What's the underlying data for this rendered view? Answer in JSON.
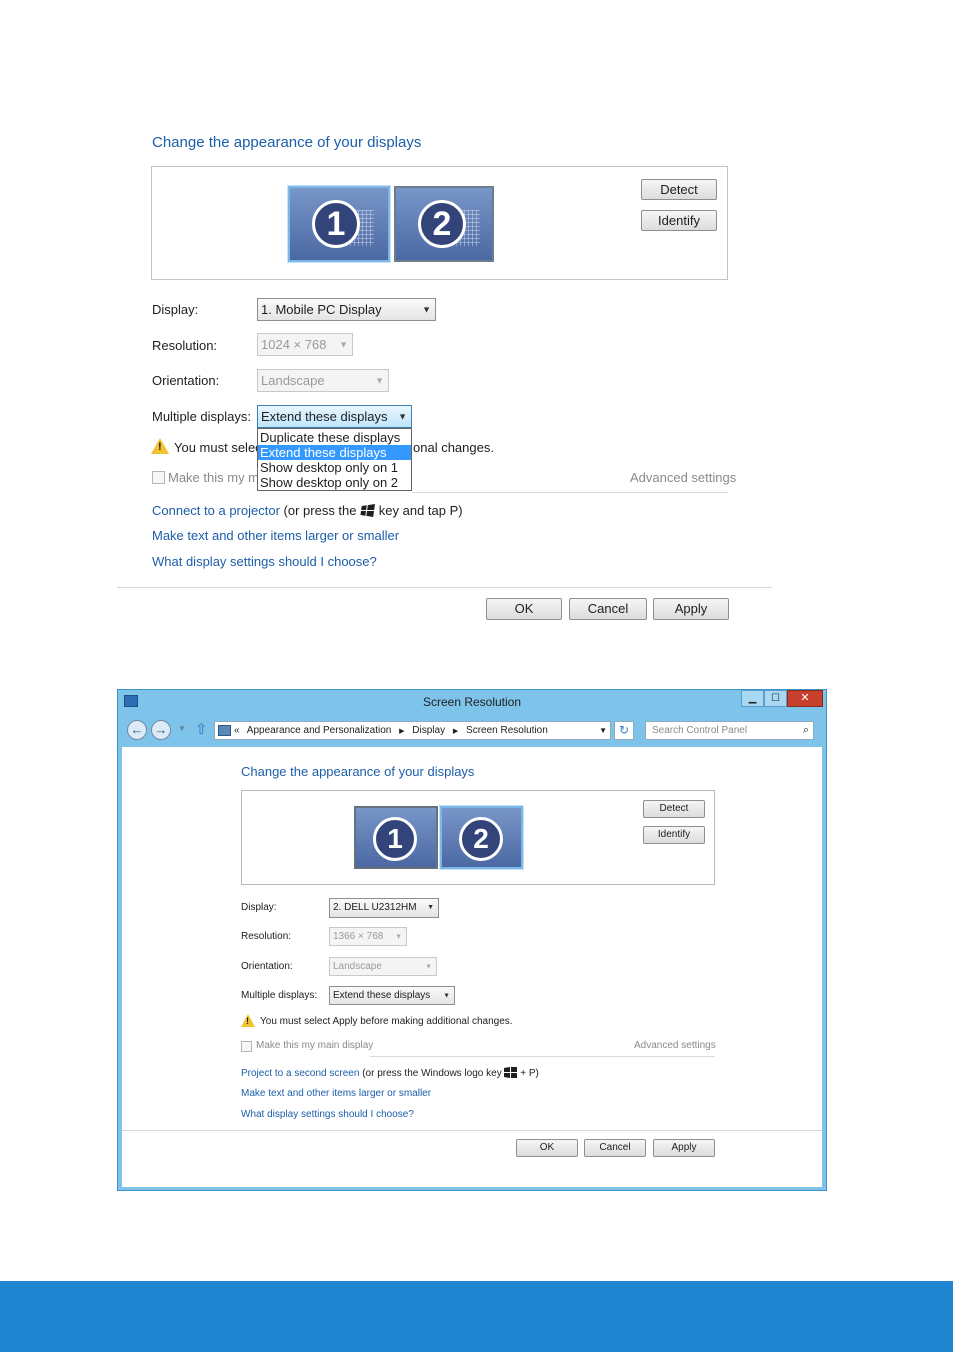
{
  "top": {
    "heading": "Change the appearance of your displays",
    "detect_label": "Detect",
    "identify_label": "Identify",
    "monitors": [
      "1",
      "2"
    ],
    "display_label": "Display:",
    "display_value": "1. Mobile PC Display",
    "resolution_label": "Resolution:",
    "resolution_value": "1024 × 768",
    "orientation_label": "Orientation:",
    "orientation_value": "Landscape",
    "multiple_label": "Multiple displays:",
    "multiple_value": "Extend these displays",
    "dropdown_options": [
      "Duplicate these displays",
      "Extend these displays",
      "Show desktop only on 1",
      "Show desktop only on 2"
    ],
    "selected_option_index": 1,
    "warning_prefix": "You must selec",
    "warning_suffix": "onal changes.",
    "main_display_text": "Make this my ma",
    "advanced_settings": "Advanced settings",
    "projector_link": "Connect to a projector",
    "projector_before": "(or press the",
    "projector_after": "key and tap P)",
    "text_size_link": "Make text and other items larger or smaller",
    "help_link": "What display settings should I choose?",
    "ok_label": "OK",
    "cancel_label": "Cancel",
    "apply_label": "Apply"
  },
  "window": {
    "title": "Screen Resolution",
    "breadcrumb": [
      "Appearance and Personalization",
      "Display",
      "Screen Resolution"
    ],
    "breadcrumb_prefix": "«",
    "search_placeholder": "Search Control Panel",
    "heading": "Change the appearance of your displays",
    "detect_label": "Detect",
    "identify_label": "Identify",
    "monitors": [
      "1",
      "2"
    ],
    "display_label": "Display:",
    "display_value": "2. DELL U2312HM",
    "resolution_label": "Resolution:",
    "resolution_value": "1366 × 768",
    "orientation_label": "Orientation:",
    "orientation_value": "Landscape",
    "multiple_label": "Multiple displays:",
    "multiple_value": "Extend these displays",
    "warning_text": "You must select Apply before making additional changes.",
    "main_display_text": "Make this my main display",
    "advanced_settings": "Advanced settings",
    "project_link": "Project to a second screen",
    "project_before": "(or press the Windows logo key",
    "project_after": "+ P)",
    "text_size_link": "Make text and other items larger or smaller",
    "help_link": "What display settings should I choose?",
    "ok_label": "OK",
    "cancel_label": "Cancel",
    "apply_label": "Apply"
  },
  "colors": {
    "link": "#1c5ea9",
    "highlight": "#3399ff",
    "title_bar": "#7ec4ea",
    "footer_band": "#2186d2",
    "close_button": "#c7402d"
  }
}
